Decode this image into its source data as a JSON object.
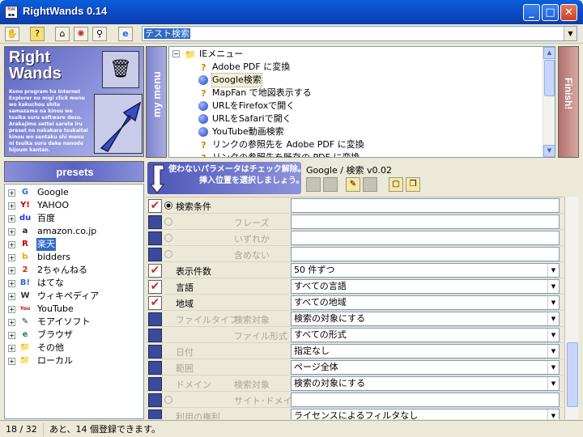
{
  "window": {
    "title": "RightWands 0.14",
    "min": "_",
    "max": "□",
    "close": "✕"
  },
  "toolbar": {
    "search_value": "テスト検索"
  },
  "logo": {
    "title_line1": "Right",
    "title_line2": "Wands",
    "desc": "Kono program ha Internet Explorer no migi click menu wo kakuchou shite samazama na kinou we tsuika suru software desu. Arakajime settei sarete iru preset no nakakara tsukaitai kinou wo sentaku shi menu ni tsuika suru dake nanode hijoum kantan."
  },
  "tabs": {
    "mymenu": "my menu",
    "finish": "Finish!"
  },
  "menu": {
    "root": "IEメニュー",
    "items": [
      {
        "label": "Adobe PDF に変換",
        "icon": "question-icon"
      },
      {
        "label": "Google検索",
        "icon": "ball-icon",
        "selected": true
      },
      {
        "label": "MapFan で地図表示する",
        "icon": "question-icon"
      },
      {
        "label": "URLをFirefoxで開く",
        "icon": "ball-icon"
      },
      {
        "label": "URLをSafariで開く",
        "icon": "ball-icon"
      },
      {
        "label": "YouTube動画検索",
        "icon": "ball-icon"
      },
      {
        "label": "リンクの参照先を Adobe PDF に変換",
        "icon": "question-icon"
      },
      {
        "label": "リンクの参照先を既存の PDF に変換",
        "icon": "question-icon"
      }
    ]
  },
  "presets": {
    "header": "presets",
    "items": [
      {
        "label": "Google",
        "icon": "G",
        "color": "#3366CC"
      },
      {
        "label": "YAHOO",
        "icon": "Y!",
        "color": "#CC0000"
      },
      {
        "label": "百度",
        "icon": "du",
        "color": "#2932E1"
      },
      {
        "label": "amazon.co.jp",
        "icon": "a",
        "color": "#222222"
      },
      {
        "label": "楽天",
        "icon": "R",
        "color": "#BF0000",
        "selected": true
      },
      {
        "label": "bidders",
        "icon": "b",
        "color": "#FF9900"
      },
      {
        "label": "2ちゃんねる",
        "icon": "2",
        "color": "#CC3300"
      },
      {
        "label": "はてな",
        "icon": "B!",
        "color": "#3366CC"
      },
      {
        "label": "ウィキペディア",
        "icon": "W",
        "color": "#333333"
      },
      {
        "label": "YouTube",
        "icon": "You",
        "color": "#CC0000"
      },
      {
        "label": "モアイソフト",
        "icon": "✎",
        "color": "#333333"
      },
      {
        "label": "ブラウザ",
        "icon": "e",
        "color": "#228833"
      },
      {
        "label": "その他",
        "icon": "📁",
        "color": "#C8A040"
      },
      {
        "label": "ローカル",
        "icon": "📁",
        "color": "#C8A040"
      }
    ]
  },
  "hint": {
    "line1": "使わないパラメータはチェック解除。",
    "line2": "挿入位置を選択しましょう。"
  },
  "engine": {
    "title": "Google / 検索 v0.02"
  },
  "params": [
    {
      "label": "検索条件",
      "sub": "",
      "type": "input",
      "checked": true,
      "radio": "on",
      "value": ""
    },
    {
      "label": "",
      "sub": "フレーズ",
      "type": "input",
      "checked": false,
      "radio": "off",
      "value": ""
    },
    {
      "label": "",
      "sub": "いずれか",
      "type": "input",
      "checked": false,
      "radio": "off",
      "value": ""
    },
    {
      "label": "",
      "sub": "含めない",
      "type": "input",
      "checked": false,
      "radio": "off",
      "value": ""
    },
    {
      "label": "表示件数",
      "sub": "",
      "type": "select",
      "checked": true,
      "radio": "none",
      "value": "50 件ずつ"
    },
    {
      "label": "言語",
      "sub": "",
      "type": "select",
      "checked": true,
      "radio": "none",
      "value": "すべての言語"
    },
    {
      "label": "地域",
      "sub": "",
      "type": "select",
      "checked": true,
      "radio": "none",
      "value": "すべての地域"
    },
    {
      "label": "ファイルタイプ",
      "sub": "検索対象",
      "type": "select",
      "checked": false,
      "radio": "none",
      "value": "検索の対象にする"
    },
    {
      "label": "",
      "sub": "ファイル形式",
      "type": "select",
      "checked": false,
      "radio": "none",
      "value": "すべての形式"
    },
    {
      "label": "日付",
      "sub": "",
      "type": "select",
      "checked": false,
      "radio": "none",
      "value": "指定なし"
    },
    {
      "label": "範囲",
      "sub": "",
      "type": "select",
      "checked": false,
      "radio": "none",
      "value": "ページ全体"
    },
    {
      "label": "ドメイン",
      "sub": "検索対象",
      "type": "select",
      "checked": false,
      "radio": "none",
      "value": "検索の対象にする"
    },
    {
      "label": "",
      "sub": "サイト･ドメイン",
      "type": "input",
      "checked": false,
      "radio": "off",
      "value": ""
    },
    {
      "label": "利用の権利",
      "sub": "",
      "type": "select",
      "checked": false,
      "radio": "none",
      "value": "ライセンスによるフィルタなし"
    }
  ],
  "status": {
    "count": "18 / 32",
    "message": "あと、14 個登録できます。"
  }
}
